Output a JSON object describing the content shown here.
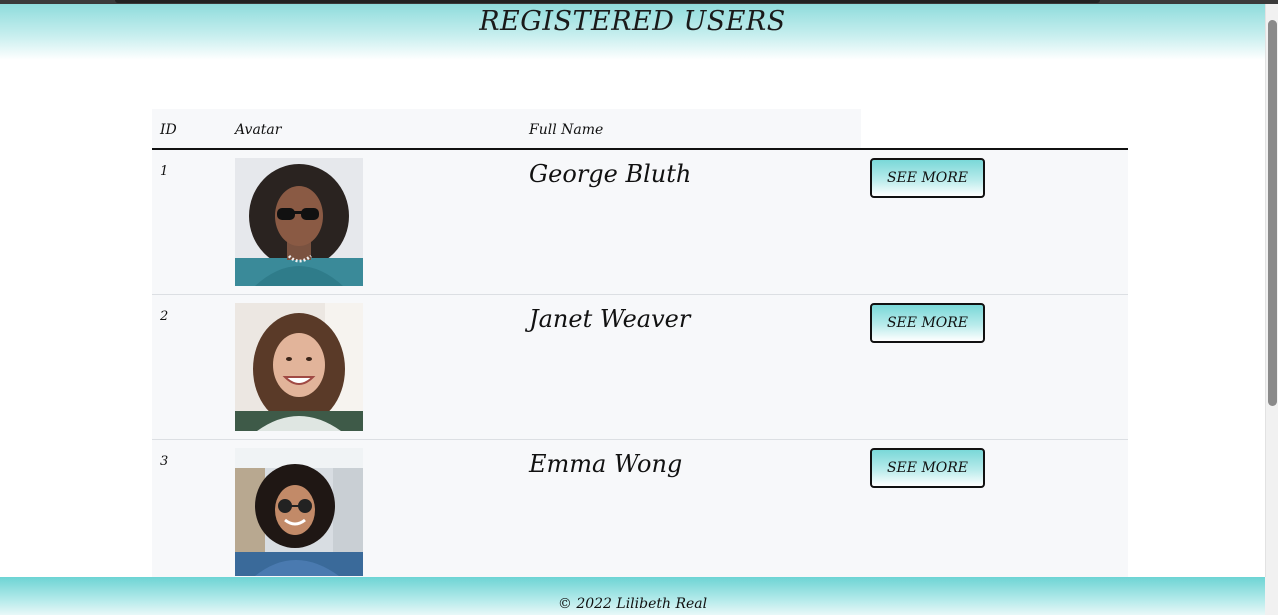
{
  "header": {
    "title": "REGISTERED USERS"
  },
  "table": {
    "columns": [
      "ID",
      "Avatar",
      "Full Name"
    ],
    "rows": [
      {
        "id": "1",
        "full_name": "George Bluth",
        "action_label": "SEE MORE"
      },
      {
        "id": "2",
        "full_name": "Janet Weaver",
        "action_label": "SEE MORE"
      },
      {
        "id": "3",
        "full_name": "Emma Wong",
        "action_label": "SEE MORE"
      }
    ]
  },
  "footer": {
    "text": "© 2022 Lilibeth Real"
  },
  "colors": {
    "accent": "#7ad8d8",
    "row_background": "#f7f8fa"
  }
}
